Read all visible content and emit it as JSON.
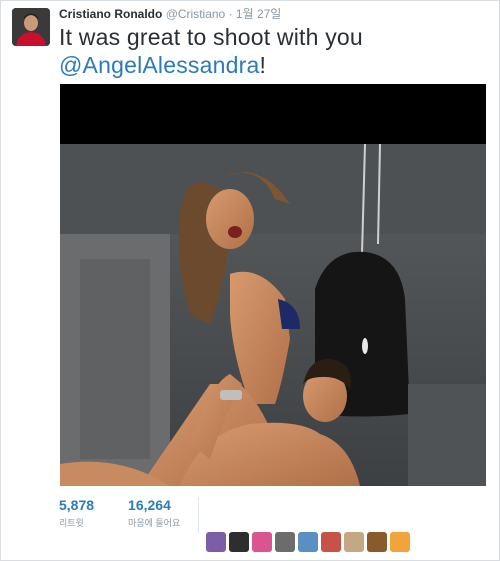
{
  "tweet": {
    "author_name": "Cristiano Ronaldo",
    "author_handle": "@Cristiano",
    "time": "1월 27일",
    "text_main": "It was great to shoot with you",
    "mention": "@AngelAlessandra",
    "text_end": "!"
  },
  "stats": {
    "retweets_count": "5,878",
    "retweets_label": "리트윗",
    "likes_count": "16,264",
    "likes_label": "마음에 들어요"
  },
  "colors": {
    "accent": "#2b7bb9",
    "muted": "#8899a6",
    "text": "#292f33"
  },
  "avatars": [
    {
      "icon": "user-avatar-purple",
      "color": "#7b5ea7"
    },
    {
      "icon": "user-avatar-dark",
      "color": "#2e2e2e"
    },
    {
      "icon": "user-avatar-pink",
      "color": "#d9558f"
    },
    {
      "icon": "user-avatar-gray",
      "color": "#6c6c6c"
    },
    {
      "icon": "user-avatar-blue",
      "color": "#5a8fc4"
    },
    {
      "icon": "user-avatar-red",
      "color": "#c6524a"
    },
    {
      "icon": "user-avatar-beige",
      "color": "#c4a783"
    },
    {
      "icon": "user-avatar-brown",
      "color": "#8a5a2b"
    },
    {
      "icon": "user-avatar-yellow",
      "color": "#f2a43a"
    }
  ]
}
